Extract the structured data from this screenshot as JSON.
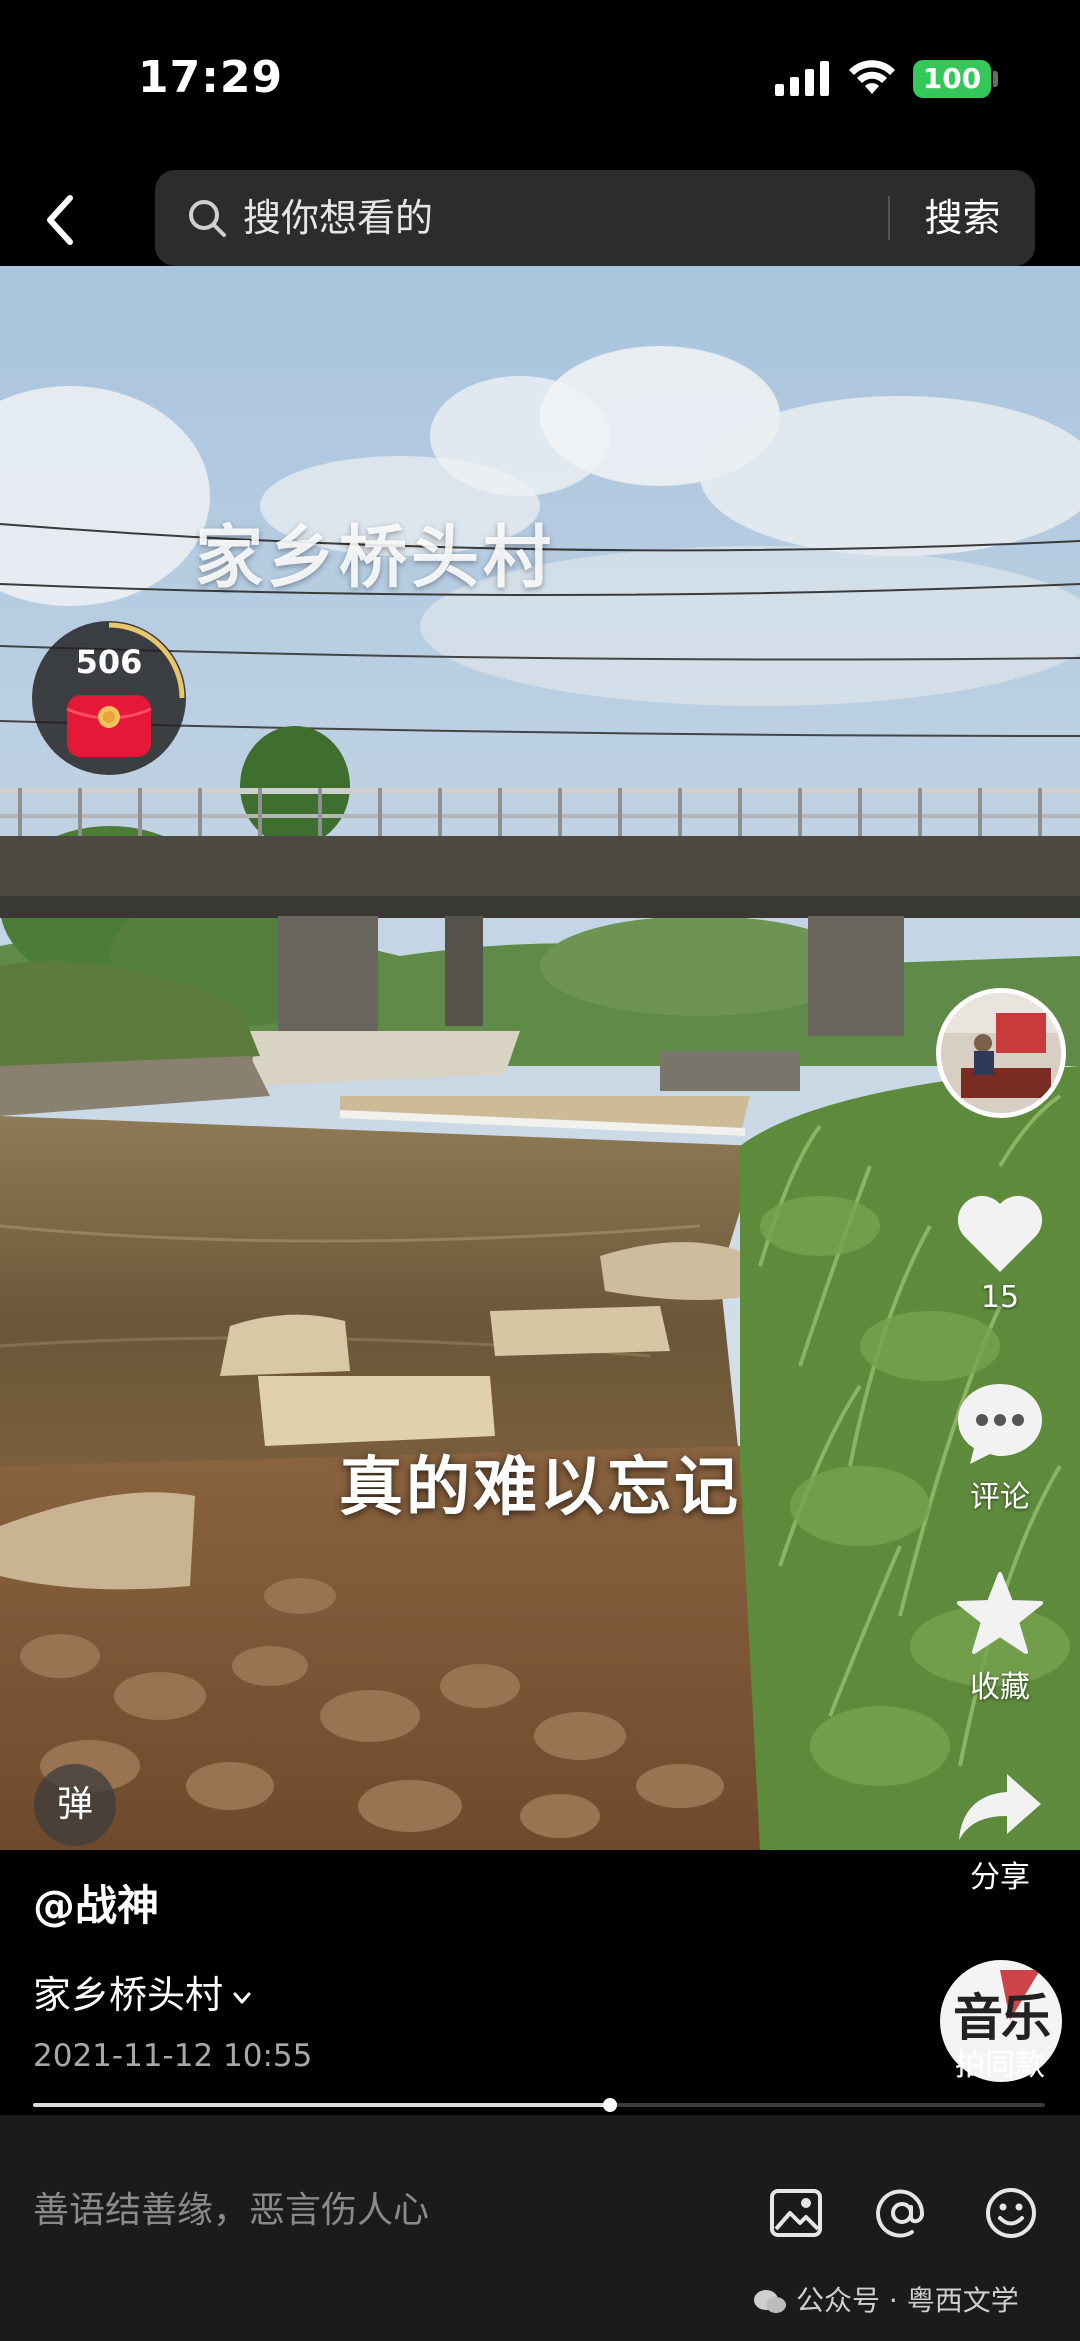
{
  "status_bar": {
    "time": "17:29",
    "battery": "100"
  },
  "search": {
    "placeholder": "搜你想看的",
    "button": "搜索"
  },
  "video": {
    "title_overlay": "家乡桥头村",
    "subtitle_overlay": "真的难以忘记",
    "red_packet_count": "506",
    "danmu_label": "弹"
  },
  "actions": {
    "like_count": "15",
    "comment_label": "评论",
    "favorite_label": "收藏",
    "share_label": "分享"
  },
  "post": {
    "author": "@战神",
    "description": "家乡桥头村",
    "date": "2021-11-12 10:55"
  },
  "music": {
    "disc_text": "音乐",
    "label": "拍同款"
  },
  "playback": {
    "progress_fraction": 0.57
  },
  "comment_bar": {
    "placeholder": "善语结善缘，恶言伤人心"
  },
  "watermark": {
    "text": "公众号 · 粤西文学"
  },
  "icons": {
    "back": "chevron-left-icon",
    "search": "search-icon",
    "like": "heart-icon",
    "comment": "comment-bubble-icon",
    "favorite": "star-icon",
    "share": "share-arrow-icon",
    "image": "image-icon",
    "mention": "at-icon",
    "emoji": "emoji-icon"
  },
  "colors": {
    "battery": "#35c759",
    "red_packet": "#e5183a",
    "background": "#000000"
  }
}
